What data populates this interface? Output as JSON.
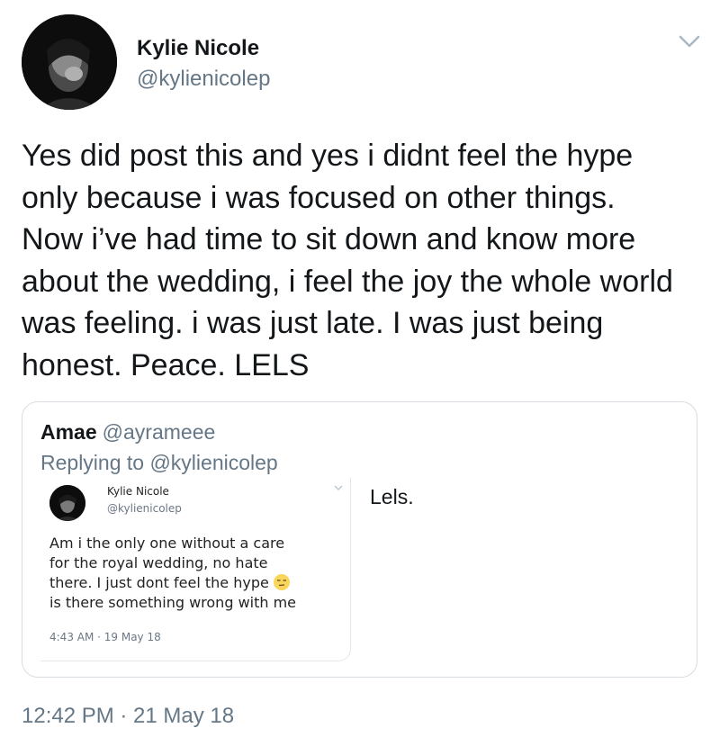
{
  "tweet": {
    "author_name": "Kylie Nicole",
    "author_handle": "@kylienicolep",
    "text_lines": [
      "Yes did post this and yes i didnt feel the hype",
      "only because i was focused on other things.",
      "Now i’ve had time to sit down and know more",
      "about the wedding, i feel the joy the whole world",
      "was feeling. i was just late. I was just being",
      "honest. Peace. LELS"
    ],
    "timestamp": "12:42 PM · 21 May 18",
    "menu_icon": "chevron-down-icon"
  },
  "quoted": {
    "author_name": "Amae",
    "author_handle": "@ayrameee",
    "replying_to": "Replying to @kylienicolep",
    "text": "Lels.",
    "embedded_screenshot": {
      "author_name": "Kylie Nicole",
      "author_handle": "@kylienicolep",
      "text_lines": [
        "Am i the only one without a care",
        "for the royal wedding, no hate",
        "there. I just dont feel the hype",
        "is there something wrong with me"
      ],
      "emoji": "unamused-face",
      "timestamp": "4:43 AM · 19 May 18"
    }
  },
  "colors": {
    "text_primary": "#14171a",
    "text_secondary": "#657786",
    "border": "#d7dde2"
  }
}
